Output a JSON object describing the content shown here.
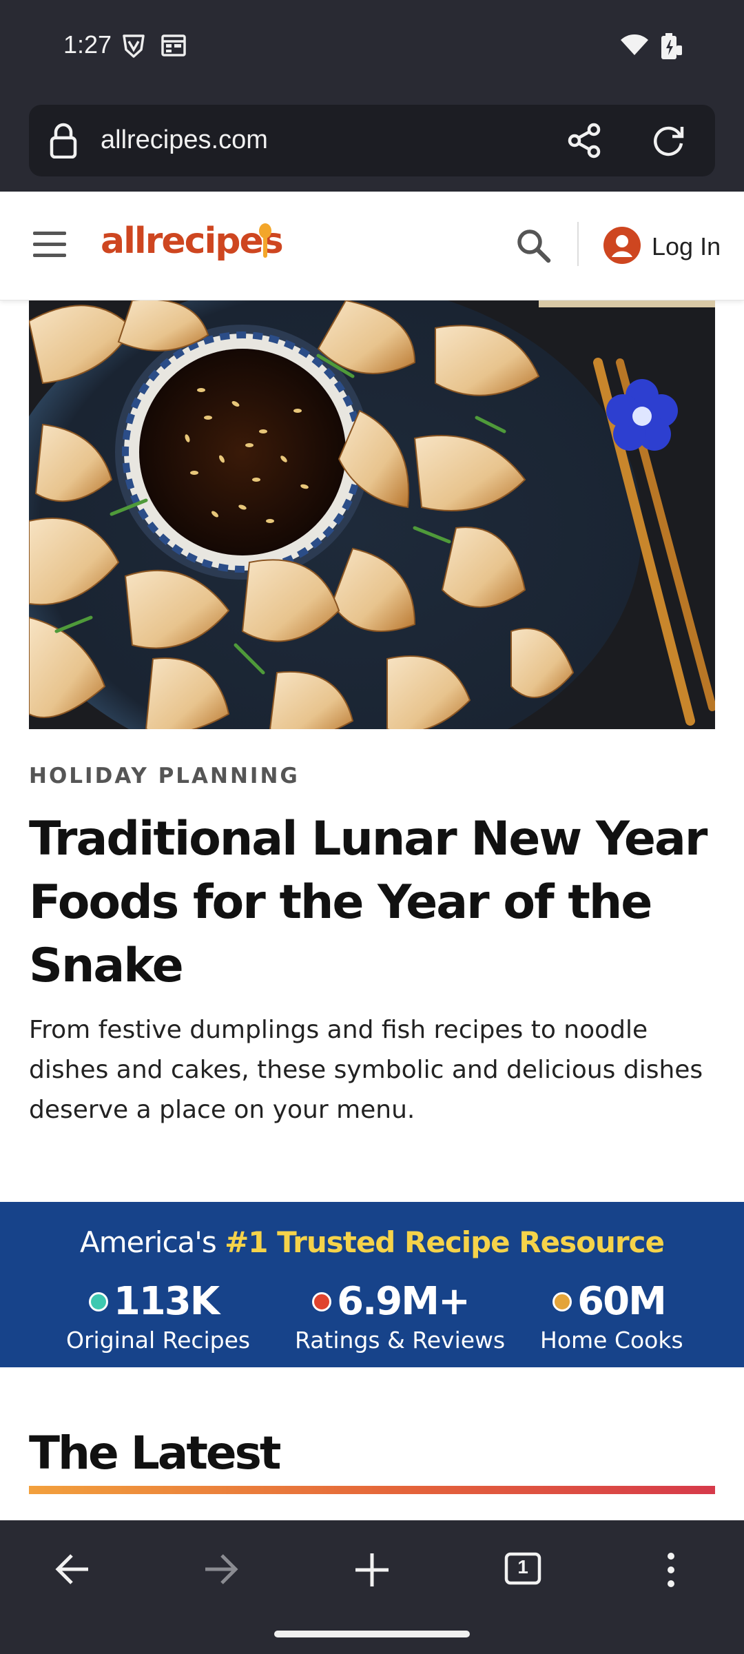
{
  "status_bar": {
    "time": "1:27",
    "icons": [
      "vpn-shield-icon",
      "calendar-icon",
      "wifi-icon",
      "battery-charging-icon"
    ]
  },
  "browser": {
    "url": "allrecipes.com",
    "icons": [
      "lock-icon",
      "share-icon",
      "reload-icon"
    ]
  },
  "site_header": {
    "logo_text": "allrecipes",
    "login_label": "Log In",
    "icons": [
      "menu-icon",
      "search-icon",
      "user-icon"
    ],
    "brand_color": "#ce4620"
  },
  "article": {
    "kicker": "HOLIDAY PLANNING",
    "headline": "Traditional Lunar New Year Foods for the Year of the Snake",
    "dek": "From festive dumplings and fish recipes to noodle dishes and cakes, these symbolic and delicious dishes deserve a place on your menu."
  },
  "trust_band": {
    "title_prefix": "America's ",
    "title_highlight": "#1 Trusted Recipe Resource",
    "background_color": "#17438a",
    "stats": [
      {
        "value": "113K",
        "label": "Original Recipes",
        "dot_color": "#3ec8b0"
      },
      {
        "value": "6.9M+",
        "label": "Ratings & Reviews",
        "dot_color": "#e0432e"
      },
      {
        "value": "60M",
        "label": "Home Cooks",
        "dot_color": "#e4a43a"
      }
    ]
  },
  "section": {
    "title": "The Latest"
  },
  "bottom_nav": {
    "tab_count": "1",
    "icons": [
      "back-arrow-icon",
      "forward-arrow-icon",
      "new-tab-icon",
      "tab-switcher-icon",
      "more-vertical-icon"
    ]
  }
}
